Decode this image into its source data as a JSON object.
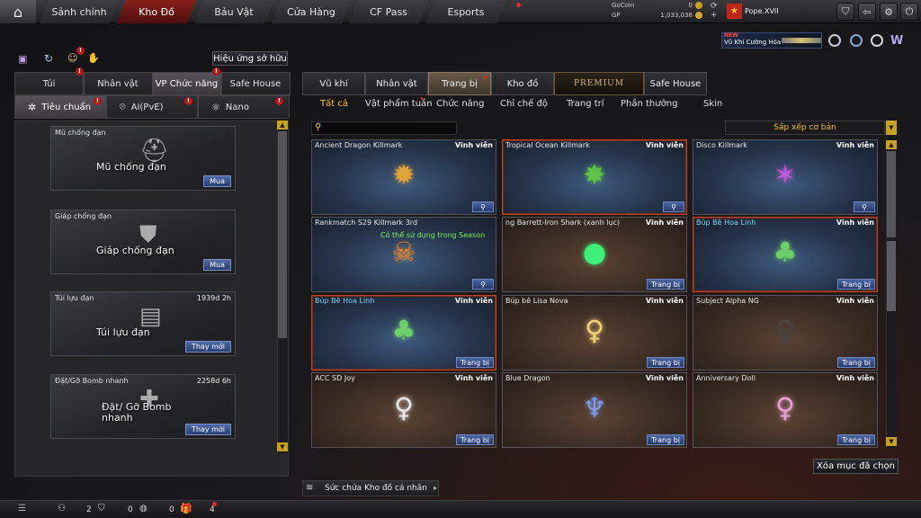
{
  "topbar": {
    "tabs": [
      "Sảnh chính",
      "Kho Đồ",
      "Bảu Vật",
      "Cửa Hàng",
      "CF Pass",
      "Esports"
    ],
    "active_tab": "Kho Đồ",
    "gocoin_label": "GoCoin",
    "gocoin_value": "0",
    "gp_label": "GP",
    "gp_value": "1,033,036",
    "username": "Pope.XVII"
  },
  "promo": {
    "new_label": "NEW",
    "title": "Vũ Khí Cường Hóa"
  },
  "left": {
    "effect_button": "Hiệu ứng sở hữu",
    "tabs": [
      "Túi",
      "Nhân vật",
      "VP Chức năng",
      "Safe House"
    ],
    "active_tab": "VP Chức năng",
    "subtabs": [
      "Tiêu chuẩn",
      "AI(PvE)",
      "Nano"
    ],
    "cards": [
      {
        "title": "Mũ chống đạn",
        "time": "",
        "big": "Mũ chống đạn",
        "action": "Mua"
      },
      {
        "title": "Giáp chống đạn",
        "time": "",
        "big": "Giáp chống đạn",
        "action": "Mua"
      },
      {
        "title": "Túi lựu đạn",
        "time": "1939d 2h",
        "big": "Túi lựu đạn",
        "action": "Thay mới"
      },
      {
        "title": "Đặt/Gỡ Bomb nhanh",
        "time": "2258d 6h",
        "big": "Đặt/ Gỡ Bomb nhanh",
        "action": "Thay mới"
      }
    ]
  },
  "right": {
    "tabs": [
      "Vũ khí",
      "Nhân vật",
      "Trang bị",
      "Kho đồ",
      "PREMIUM",
      "Safe House"
    ],
    "active_tab": "Trang bị",
    "subtabs": [
      "Tất cả",
      "Vật phẩm tuần",
      "Chức năng",
      "Chỉ chế độ",
      "Trang trí",
      "Phần thưởng",
      "Skin"
    ],
    "active_subtab": "Tất cả",
    "search_placeholder": "",
    "sort_label": "Sắp xếp cơ bản",
    "items": [
      {
        "name": "Ancient Dragon Killmark",
        "perm": "Vĩnh viễn",
        "style": "blue",
        "button": "zoom",
        "note": "",
        "art": "dragon"
      },
      {
        "name": "Tropical Ocean Killmark",
        "perm": "Vĩnh viễn",
        "style": "blue sel",
        "button": "zoom",
        "note": "",
        "art": "star-green"
      },
      {
        "name": "Disco Killmark",
        "perm": "Vĩnh viễn",
        "style": "blue",
        "button": "zoom",
        "note": "",
        "art": "star-rainbow"
      },
      {
        "name": "Rankmatch S29 Killmark 3rd",
        "perm": "",
        "style": "blue",
        "button": "zoom",
        "note": "Có thể sử dụng trong Season",
        "art": "skull"
      },
      {
        "name": "ng Barrett-Iron Shark (xanh lục)",
        "perm": "Vĩnh viễn",
        "style": "brown",
        "button": "Trang bị",
        "note": "",
        "art": "orb"
      },
      {
        "name": "Búp Bê Hoa Linh",
        "perm": "Vĩnh viễn",
        "style": "blue sel",
        "button": "Trang bị",
        "note": "",
        "art": "doll-green",
        "cyan": true
      },
      {
        "name": "Búp Bê Hoa Linh",
        "perm": "Vĩnh viễn",
        "style": "blue sel",
        "button": "Trang bị",
        "note": "",
        "art": "doll-green",
        "cyan": true
      },
      {
        "name": "Búp bê Lisa Nova",
        "perm": "Vĩnh viễn",
        "style": "brown",
        "button": "Trang bị",
        "note": "",
        "art": "doll-blonde"
      },
      {
        "name": "Subject Alpha NG",
        "perm": "Vĩnh viễn",
        "style": "brown",
        "button": "Trang bị",
        "note": "",
        "art": "doll-dark"
      },
      {
        "name": "ACC SD Joy",
        "perm": "Vĩnh viễn",
        "style": "brown",
        "button": "Trang bị",
        "note": "",
        "art": "doll-white"
      },
      {
        "name": "Blue Dragon",
        "perm": "Vĩnh viễn",
        "style": "brown",
        "button": "Trang bị",
        "note": "",
        "art": "doll-blue"
      },
      {
        "name": "Anniversary Doll",
        "perm": "Vĩnh viễn",
        "style": "brown",
        "button": "Trang bị",
        "note": "",
        "art": "doll-pink"
      }
    ],
    "clear_button": "Xóa mục đã chọn",
    "storage_label": "Sức chứa Kho đồ cá nhân"
  },
  "bottombar": {
    "count1": "2",
    "count2": "0",
    "count3": "0",
    "count4": "4"
  },
  "colors": {
    "accent_red": "#8a1f1a",
    "gold": "#f1c232",
    "button_blue": "#27396a"
  }
}
